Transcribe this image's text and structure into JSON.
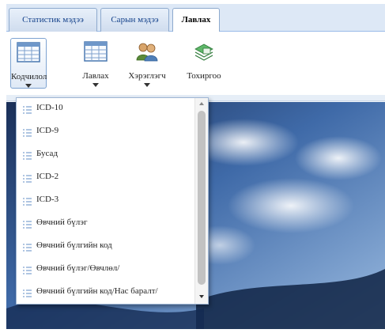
{
  "tabs": [
    {
      "label": "Статистик мэдээ",
      "active": false
    },
    {
      "label": "Сарын мэдээ",
      "active": false
    },
    {
      "label": "Лавлах",
      "active": true
    }
  ],
  "ribbon": {
    "buttons": [
      {
        "label": "Кодчилол",
        "icon": "table-icon",
        "has_dropdown": true,
        "selected": true
      },
      {
        "label": "Лавлах",
        "icon": "table-icon",
        "has_dropdown": true,
        "selected": false
      },
      {
        "label": "Хэрэглэгч",
        "icon": "users-icon",
        "has_dropdown": true,
        "selected": false
      },
      {
        "label": "Тохиргоо",
        "icon": "settings-stack-icon",
        "has_dropdown": false,
        "selected": false
      }
    ]
  },
  "dropdown": {
    "items": [
      {
        "label": "ICD-10",
        "icon": "list-icon"
      },
      {
        "label": "ICD-9",
        "icon": "list-icon"
      },
      {
        "label": "Бусад",
        "icon": "list-icon"
      },
      {
        "label": "ICD-2",
        "icon": "list-icon"
      },
      {
        "label": "ICD-3",
        "icon": "list-icon"
      },
      {
        "label": "Өвчний бүлэг",
        "icon": "list-icon"
      },
      {
        "label": "Өвчний бүлгийн код",
        "icon": "list-icon"
      },
      {
        "label": "Өвчний бүлэг/Өвчлөл/",
        "icon": "list-icon"
      },
      {
        "label": "Өвчний бүлгийн код/Нас баралт/",
        "icon": "list-icon"
      }
    ]
  },
  "colors": {
    "tab_strip": "#dde8f6",
    "tab_border": "#8eaace",
    "tab_text": "#15428b",
    "selected_button_border": "#7ea3d1",
    "dropdown_border": "#9fb6d4",
    "list_icon": "#7aa0cf"
  }
}
